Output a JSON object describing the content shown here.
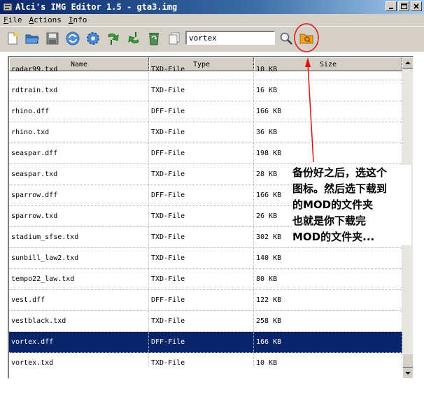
{
  "window": {
    "title": "Alci's IMG Editor 1.5 - gta3.img"
  },
  "menu": [
    {
      "accel": "F",
      "rest": "ile"
    },
    {
      "accel": "A",
      "rest": "ctions"
    },
    {
      "accel": "I",
      "rest": "nfo"
    }
  ],
  "toolbar": {
    "search_value": "vortex",
    "icons": [
      "new-file-icon",
      "open-folder-icon",
      "save-icon",
      "refresh-icon",
      "settings-icon",
      "import-icon",
      "export-icon",
      "delete-icon",
      "copy-icon",
      "search-icon",
      "open-mod-folder-icon"
    ]
  },
  "table": {
    "columns": [
      "Name",
      "Type",
      "Size"
    ],
    "rows": [
      {
        "name": "radar99.txd",
        "type": "TXD-File",
        "size": "10 KB"
      },
      {
        "name": "rdtrain.txd",
        "type": "TXD-File",
        "size": "16 KB"
      },
      {
        "name": "rhino.dff",
        "type": "DFF-File",
        "size": "166 KB"
      },
      {
        "name": "rhino.txd",
        "type": "TXD-File",
        "size": "36 KB"
      },
      {
        "name": "seaspar.dff",
        "type": "DFF-File",
        "size": "198 KB"
      },
      {
        "name": "seaspar.txd",
        "type": "TXD-File",
        "size": "28 KB"
      },
      {
        "name": "sparrow.dff",
        "type": "DFF-File",
        "size": "166 KB"
      },
      {
        "name": "sparrow.txd",
        "type": "TXD-File",
        "size": "26 KB"
      },
      {
        "name": "stadium_sfse.txd",
        "type": "TXD-File",
        "size": "302 KB"
      },
      {
        "name": "sunbill_law2.txd",
        "type": "TXD-File",
        "size": "140 KB"
      },
      {
        "name": "tempo22_law.txd",
        "type": "TXD-File",
        "size": "80 KB"
      },
      {
        "name": "vest.dff",
        "type": "DFF-File",
        "size": "122 KB"
      },
      {
        "name": "vestblack.txd",
        "type": "TXD-File",
        "size": "258 KB"
      },
      {
        "name": "vortex.dff",
        "type": "DFF-File",
        "size": "166 KB"
      },
      {
        "name": "vortex.txd",
        "type": "TXD-File",
        "size": "10 KB"
      }
    ],
    "selected_index": 13
  },
  "annotation": {
    "lines": [
      "备份好之后，选这个",
      "图标。然后选下载到",
      "的MOD的文件夹",
      "也就是你下载完",
      "MOD的文件夹..."
    ],
    "color": "#e01010"
  }
}
